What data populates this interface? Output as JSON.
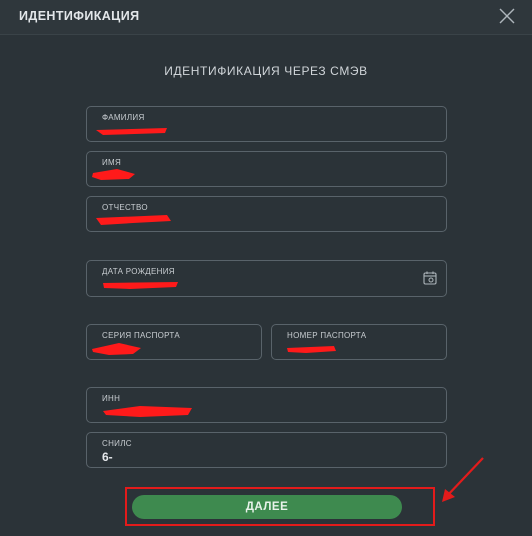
{
  "dialog": {
    "title": "ИДЕНТИФИКАЦИЯ",
    "subtitle": "ИДЕНТИФИКАЦИЯ  ЧЕРЕЗ СМЭВ"
  },
  "fields": {
    "last_name": {
      "label": "ФАМИЛИЯ"
    },
    "first_name": {
      "label": "ИМЯ"
    },
    "patronymic": {
      "label": "ОТЧЕСТВО"
    },
    "birth_date": {
      "label": "ДАТА РОЖДЕНИЯ"
    },
    "passport_series": {
      "label": "СЕРИЯ ПАСПОРТА"
    },
    "passport_number": {
      "label": "НОМЕР ПАСПОРТА"
    },
    "inn": {
      "label": "ИНН"
    },
    "snils": {
      "label": "СНИЛС",
      "value": "6-"
    }
  },
  "actions": {
    "next_label": "ДАЛЕЕ"
  },
  "icons": {
    "close": "close-icon",
    "calendar": "calendar-icon"
  },
  "colors": {
    "accent_button": "#3e8a4f",
    "highlight": "#e31b1b",
    "background": "#2b3338"
  }
}
